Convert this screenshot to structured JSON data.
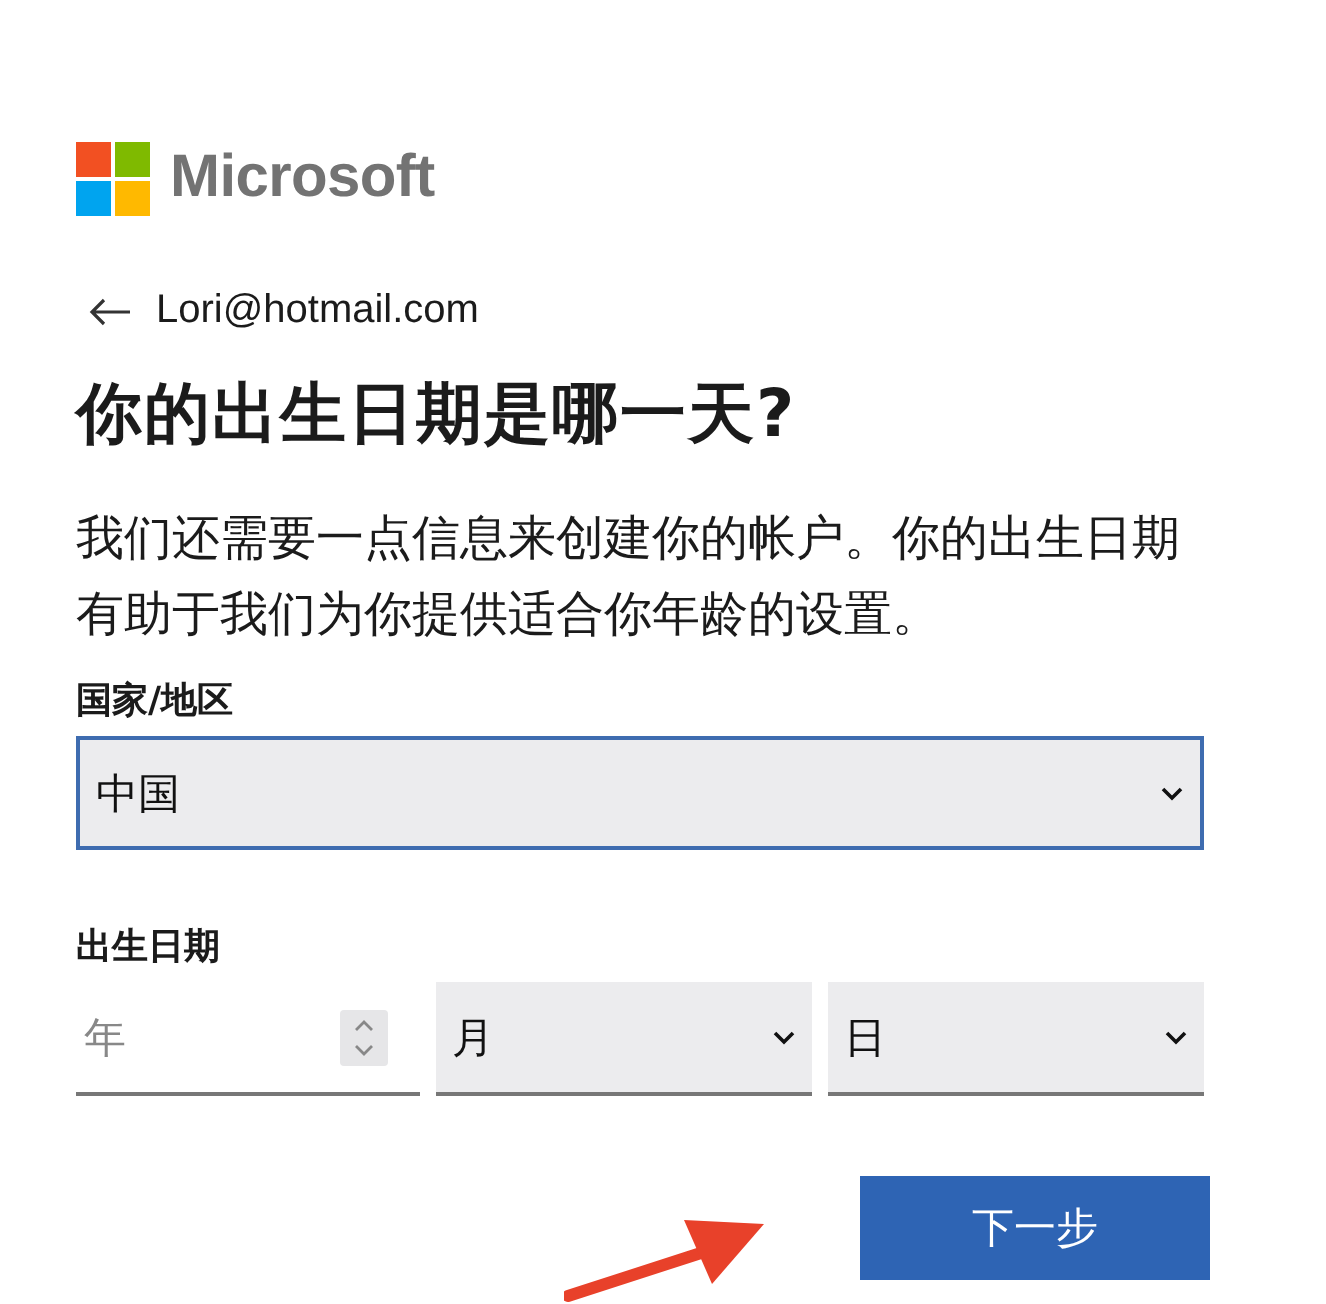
{
  "logo": {
    "text": "Microsoft"
  },
  "back": {
    "email": "Lori@hotmail.com"
  },
  "heading": "你的出生日期是哪一天?",
  "description": "我们还需要一点信息来创建你的帐户。你的出生日期有助于我们为你提供适合你年龄的设置。",
  "country": {
    "label": "国家/地区",
    "value": "中国"
  },
  "birthdate": {
    "label": "出生日期",
    "year": {
      "placeholder": "年"
    },
    "month": {
      "value": "月"
    },
    "day": {
      "value": "日"
    }
  },
  "buttons": [
    {
      "label": "下一步",
      "kind": "primary"
    }
  ],
  "annotation": {
    "kind": "arrow"
  }
}
